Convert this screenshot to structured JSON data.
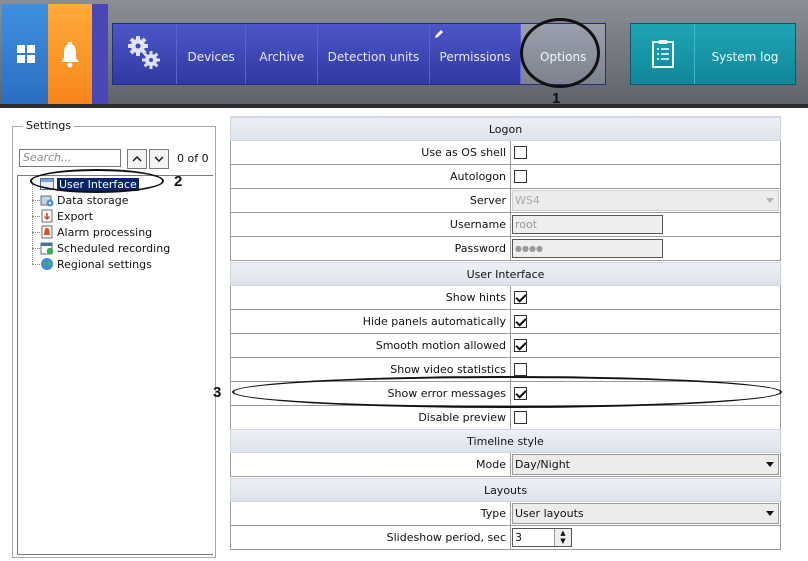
{
  "toolbar": {
    "tabs": [
      {
        "label": "Devices"
      },
      {
        "label": "Archive"
      },
      {
        "label": "Detection units"
      },
      {
        "label": "Permissions"
      },
      {
        "label": "Options"
      }
    ],
    "system_log_label": "System log",
    "icons": {
      "windows": "windows-grid-icon",
      "alarm": "bell-icon",
      "settings": "gears-icon",
      "permissions": "pencil-icon",
      "system_log": "clipboard-list-icon"
    },
    "colors": {
      "blue": "#3f8fe0",
      "orange": "#f7861b",
      "tabbar": "#3a44b4",
      "teal": "#1a9aab"
    }
  },
  "settings_panel": {
    "title": "Settings",
    "search": {
      "placeholder": "Search...",
      "value": ""
    },
    "count": "0 of 0",
    "tree": [
      {
        "label": "User Interface",
        "selected": true,
        "icon": "window-icon"
      },
      {
        "label": "Data storage",
        "icon": "disk-gear-icon"
      },
      {
        "label": "Export",
        "icon": "export-icon"
      },
      {
        "label": "Alarm processing",
        "icon": "alarm-icon"
      },
      {
        "label": "Scheduled recording",
        "icon": "calendar-icon"
      },
      {
        "label": "Regional settings",
        "icon": "globe-icon"
      }
    ]
  },
  "properties": {
    "logon": {
      "header": "Logon",
      "use_os_shell": {
        "label": "Use as OS shell",
        "checked": false
      },
      "autologon": {
        "label": "Autologon",
        "checked": false
      },
      "server": {
        "label": "Server",
        "value": "WS4"
      },
      "username": {
        "label": "Username",
        "value": "root"
      },
      "password": {
        "label": "Password",
        "value": "●●●●"
      }
    },
    "user_interface": {
      "header": "User Interface",
      "show_hints": {
        "label": "Show hints",
        "checked": true
      },
      "hide_panels": {
        "label": "Hide panels automatically",
        "checked": true
      },
      "smooth_motion": {
        "label": "Smooth motion allowed",
        "checked": true
      },
      "show_video_stats": {
        "label": "Show video statistics",
        "checked": false
      },
      "show_error_messages": {
        "label": "Show error messages",
        "checked": true
      },
      "disable_preview": {
        "label": "Disable preview",
        "checked": false
      }
    },
    "timeline": {
      "header": "Timeline style",
      "mode": {
        "label": "Mode",
        "value": "Day/Night"
      }
    },
    "layouts": {
      "header": "Layouts",
      "type": {
        "label": "Type",
        "value": "User layouts"
      },
      "slideshow": {
        "label": "Slideshow period, sec",
        "value": "3"
      }
    }
  },
  "annotations": {
    "one": "1",
    "two": "2",
    "three": "3"
  }
}
